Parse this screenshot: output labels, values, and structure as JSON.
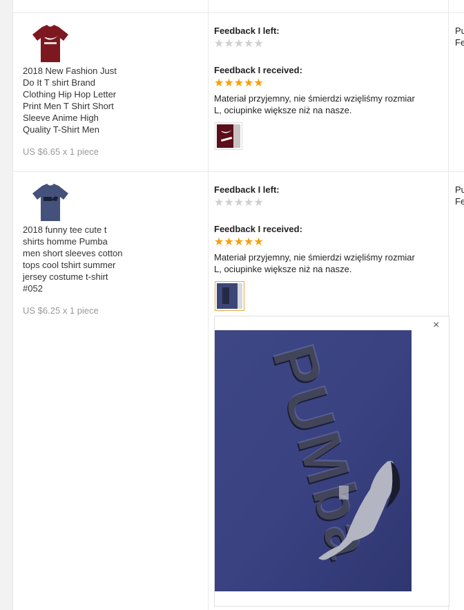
{
  "colors": {
    "star_on": "#f5a00a",
    "star_off": "#cfcfcf",
    "price": "#999999",
    "active_border": "#e8a83c"
  },
  "orders": [
    {
      "title_lines": [
        "2018 New Fashion Just",
        "Do It T shirt Brand",
        "Clothing Hip Hop Letter",
        "Print Men T Shirt Short",
        "Sleeve Anime High",
        "Quality T-Shirt Men"
      ],
      "price": "US $6.65 x 1 piece",
      "feedback_left_label": "Feedback I left:",
      "feedback_left_stars": "★★★★★",
      "feedback_received_label": "Feedback I received:",
      "feedback_received_stars": "★★★★★",
      "comment_lines": [
        "Materiał przyjemny, nie śmierdzi wzięliśmy rozmiar",
        "L, ociupinke większe niż na nasze."
      ],
      "cut_lines": [
        "Pu",
        "Fe"
      ]
    },
    {
      "title_lines": [
        "2018 funny tee cute t",
        "shirts homme Pumba",
        "men short sleeves cotton",
        "tops cool tshirt summer",
        "jersey costume t-shirt",
        "#052"
      ],
      "price": "US $6.25 x 1 piece",
      "feedback_left_label": "Feedback I left:",
      "feedback_left_stars": "★★★★★",
      "feedback_received_label": "Feedback I received:",
      "feedback_received_stars": "★★★★★",
      "comment_lines": [
        "Materiał przyjemny, nie śmierdzi wzięliśmy rozmiar",
        "L, ociupinke większe niż na nasze."
      ],
      "cut_lines": [
        "Pu",
        "Fe"
      ]
    }
  ],
  "popup": {
    "close_glyph": "×",
    "icon": "close-icon"
  }
}
